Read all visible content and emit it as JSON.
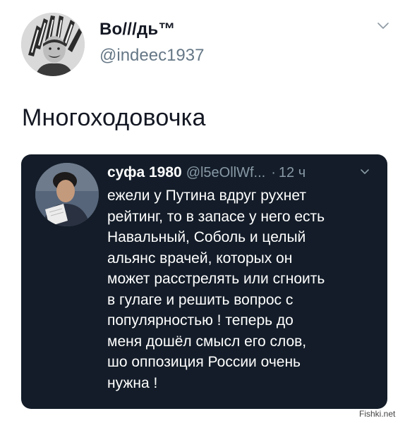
{
  "outer_tweet": {
    "display_name": "Во///дь™",
    "handle": "@indeec1937",
    "text": "Многоходовочка",
    "avatar_icon": "avatar-headdress-portrait",
    "menu_icon": "chevron-down-icon"
  },
  "quoted_tweet": {
    "display_name": "суфа 1980",
    "handle": "@l5eOllWf...",
    "separator": "·",
    "time": "12 ч",
    "avatar_icon": "avatar-man-reading-paper",
    "menu_icon": "chevron-down-icon",
    "lines": [
      "ежели у Путина вдруг рухнет",
      "рейтинг, то в запасе у него есть",
      "Навальный, Соболь и целый",
      "альянс врачей, которых он",
      "может расстрелять или сгноить",
      "в гулаге и решить вопрос с",
      "популярностью ! теперь до",
      "меня дошёл смысл его слов,",
      "шо оппозиция России очень",
      "нужна !"
    ]
  },
  "watermark": "Fishki.net",
  "colors": {
    "card_background": "#131c28",
    "muted_text": "#8899a6",
    "outer_handle": "#657786",
    "primary_text": "#141823"
  }
}
